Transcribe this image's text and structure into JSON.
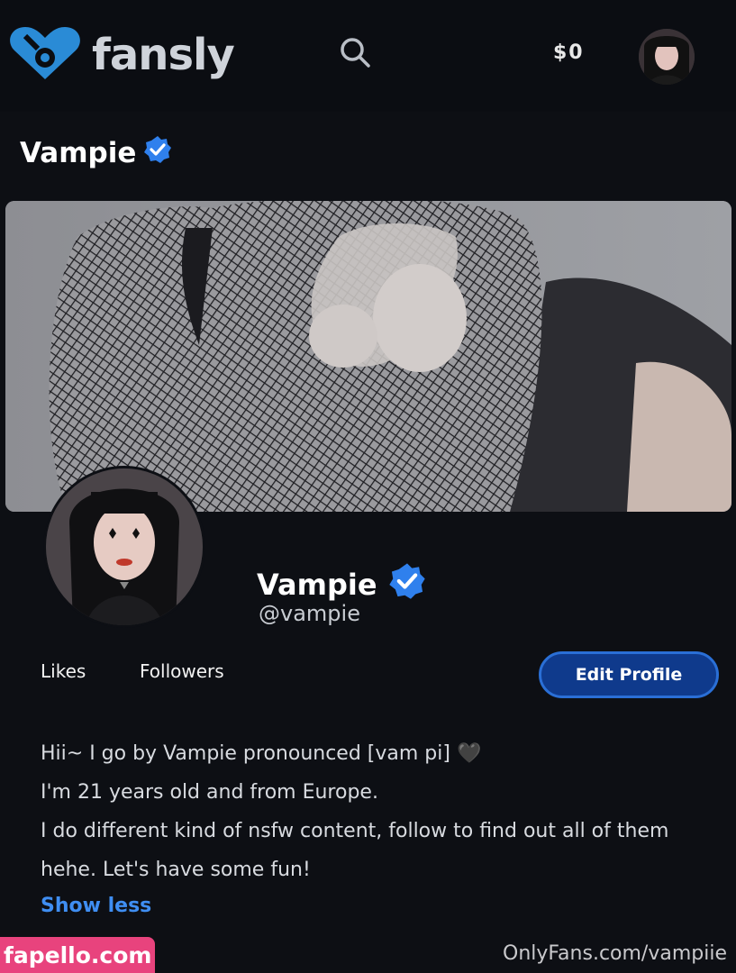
{
  "app": {
    "logo_text": "fansly",
    "balance": "$0"
  },
  "icons": {
    "logo": "fansly-heart-logo-icon",
    "search": "search-icon",
    "verified": "verified-badge-icon"
  },
  "colors": {
    "background": "#0d0f14",
    "accent_blue": "#3f8ef2",
    "button_blue": "#0f3a8c",
    "verified_blue": "#2f80ed"
  },
  "profile": {
    "header_name": "Vampie",
    "display_name": "Vampie",
    "handle": "@vampie",
    "stats": {
      "likes_label": "Likes",
      "followers_label": "Followers"
    },
    "edit_button": "Edit Profile",
    "bio": [
      "Hii~ I go by Vampie pronounced [vam pi] 🖤",
      "I'm 21 years old and from Europe.",
      "I do different kind of nsfw content, follow to find out all of them",
      "hehe. Let's have some fun!"
    ],
    "show_less": "Show less"
  },
  "watermarks": {
    "left": "fapello.com",
    "right": "OnlyFans.com/vampiie"
  }
}
